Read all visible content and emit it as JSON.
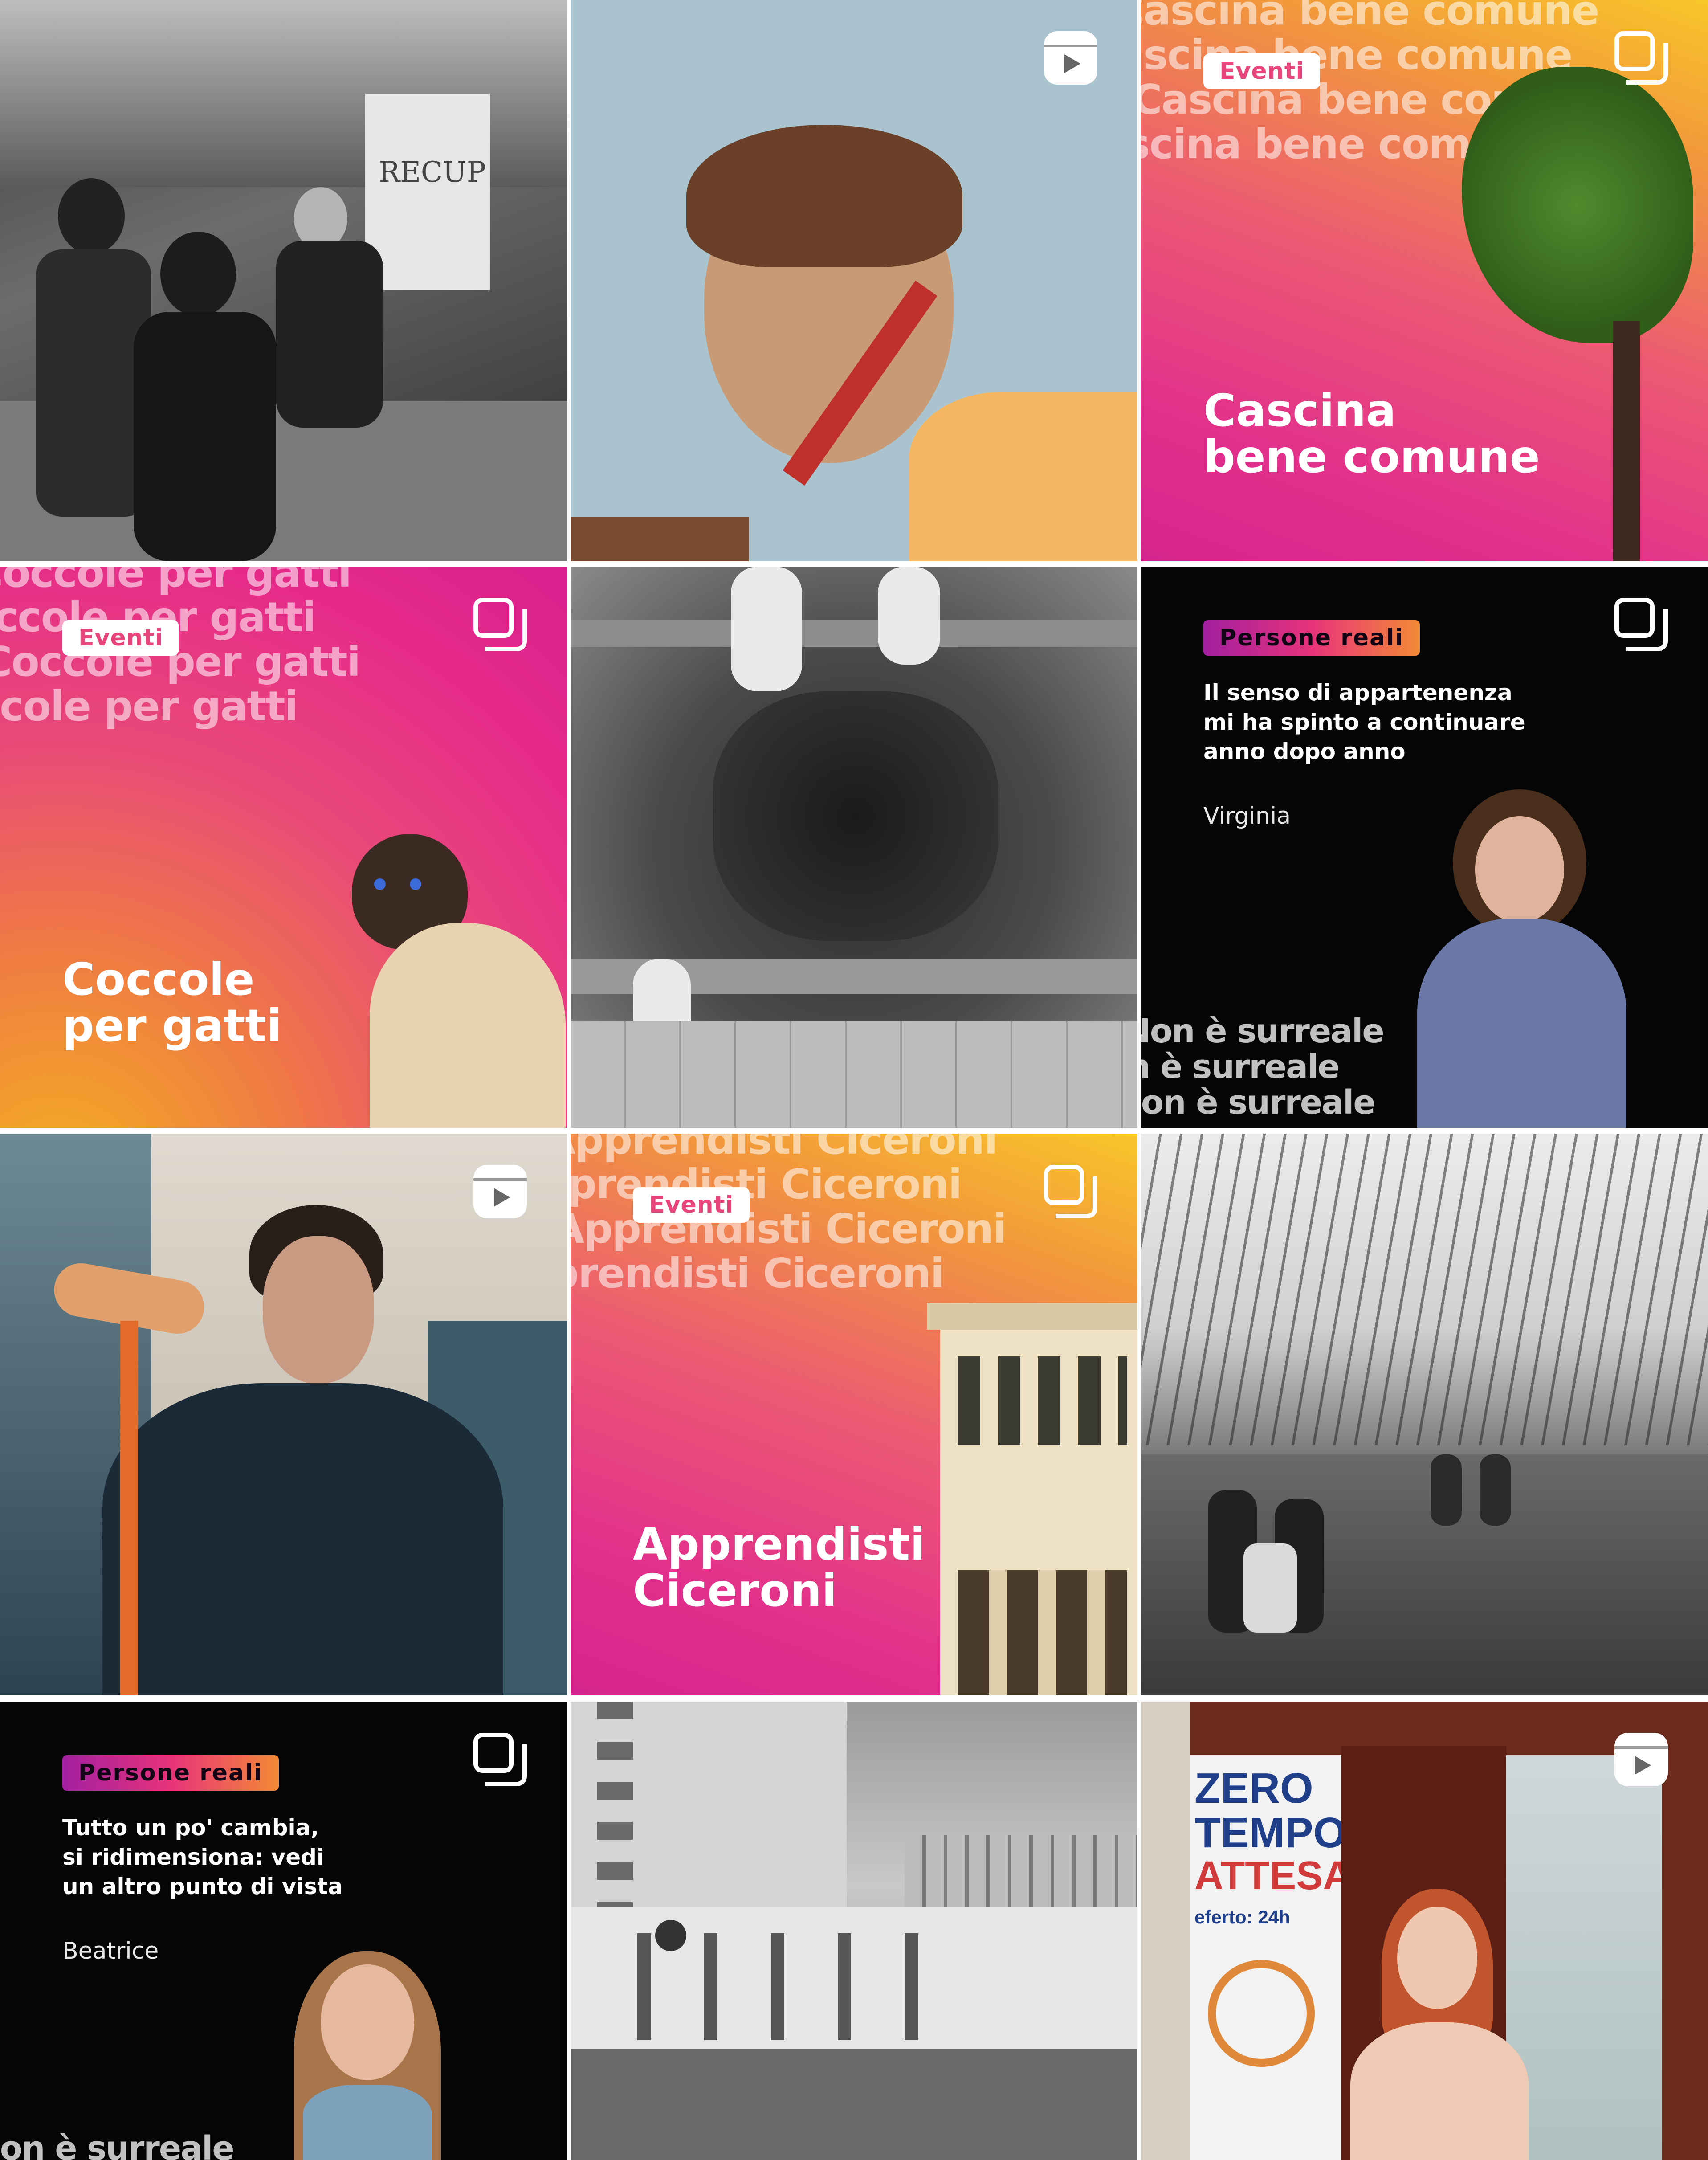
{
  "tiles": [
    {
      "type": "photo-bw",
      "subject": "volunteers-food-bank",
      "icon": null,
      "sign_text": "RECUP"
    },
    {
      "type": "photo",
      "subject": "young-man-with-garden-tool",
      "icon": "reel-icon"
    },
    {
      "type": "event",
      "badge": "Eventi",
      "title": "Cascina\nbene comune",
      "wave_text": "Cascina bene comune",
      "icon": "carousel-icon"
    },
    {
      "type": "event",
      "badge": "Eventi",
      "title": "Coccole\nper gatti",
      "wave_text": "Coccole per gatti",
      "icon": "carousel-icon"
    },
    {
      "type": "photo-bw",
      "subject": "hands-gardening-compost",
      "icon": null
    },
    {
      "type": "quote",
      "badge": "Persone reali",
      "quote": "Il senso di appartenenza\nmi ha spinto a continuare\nanno dopo anno",
      "name": "Virginia",
      "wave_text": "Non è surreale",
      "icon": "carousel-icon"
    },
    {
      "type": "photo",
      "subject": "young-man-with-paint-roller",
      "icon": "reel-icon"
    },
    {
      "type": "event",
      "badge": "Eventi",
      "title": "Apprendisti\nCiceroni",
      "wave_text": "Apprendisti Ciceroni",
      "icon": "carousel-icon"
    },
    {
      "type": "photo-bw",
      "subject": "kids-cleaning-park",
      "icon": null
    },
    {
      "type": "quote",
      "badge": "Persone reali",
      "quote": "Tutto un po' cambia,\nsi ridimensiona: vedi\nun altro punto di vista",
      "name": "Beatrice",
      "wave_text": "Non è surreale",
      "icon": "carousel-icon"
    },
    {
      "type": "photo-bw",
      "subject": "building-street-corner",
      "icon": null
    },
    {
      "type": "photo",
      "subject": "young-woman-pharmacy-entrance",
      "icon": "reel-icon",
      "sign_lines": [
        "ZERO",
        "TEMPO",
        "ATTESA"
      ],
      "sign_small": "eferto: 24h"
    }
  ]
}
